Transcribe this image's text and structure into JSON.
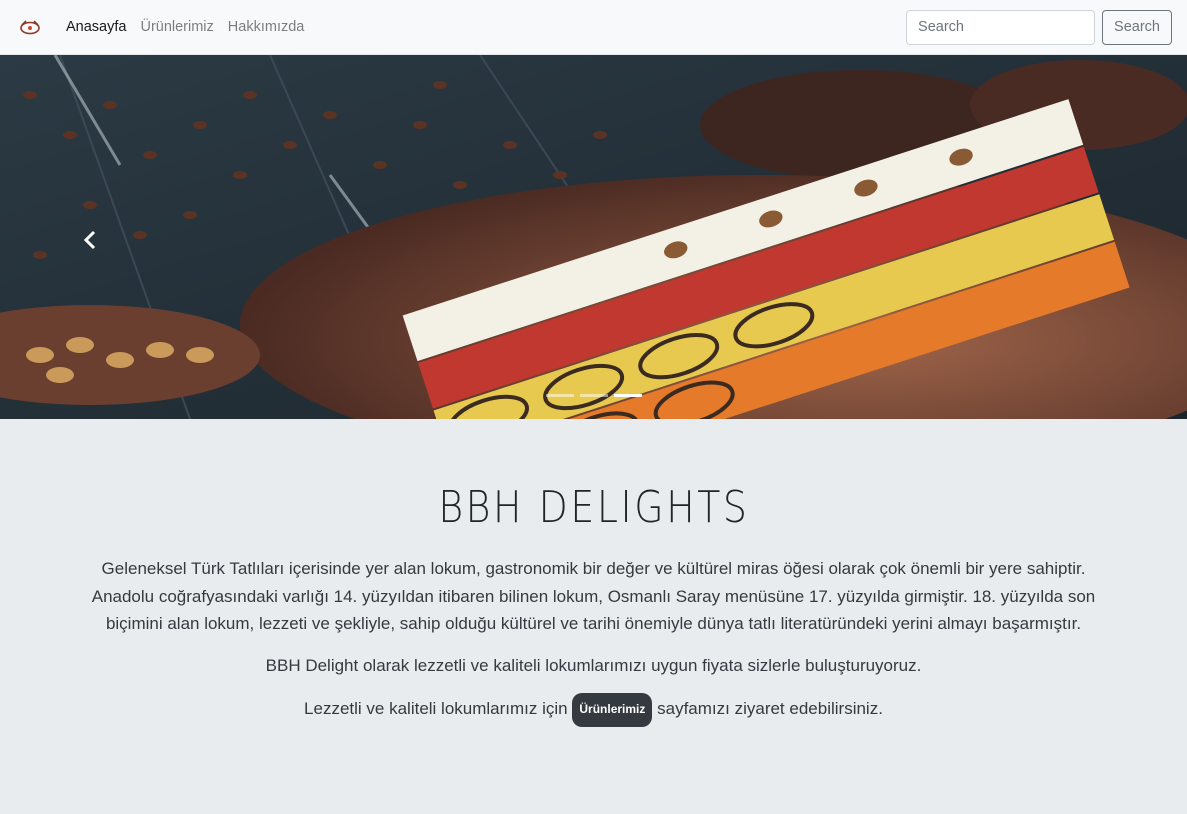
{
  "nav": {
    "brand_icon": "lokum-logo-icon",
    "links": [
      {
        "label": "Anasayfa",
        "active": true
      },
      {
        "label": "Ürünlerimiz",
        "active": false
      },
      {
        "label": "Hakkımızda",
        "active": false
      }
    ],
    "search": {
      "placeholder": "Search",
      "button_label": "Search"
    }
  },
  "carousel": {
    "prev_icon": "chevron-left-icon",
    "slides": 3,
    "active_slide": 3,
    "image": "turkish-delight-tray-photo"
  },
  "main": {
    "title": "BBH DELIGHTS",
    "paragraph1": "Geleneksel Türk Tatlıları içerisinde yer alan lokum, gastronomik bir değer ve kültürel miras öğesi olarak çok önemli bir yere sahiptir. Anadolu coğrafyasındaki varlığı 14. yüzyıldan itibaren bilinen lokum, Osmanlı Saray menüsüne 17. yüzyılda girmiştir. 18. yüzyılda son biçimini alan lokum, lezzeti ve şekliyle, sahip olduğu kültürel ve tarihi önemiyle dünya tatlı literatüründeki yerini almayı başarmıştır.",
    "paragraph2": "BBH Delight olarak lezzetli ve kaliteli lokumlarımızı uygun fiyata sizlerle buluşturuyoruz.",
    "paragraph3_before": "Lezzetli ve kaliteli lokumlarımız için",
    "paragraph3_badge": "Ürünlerimiz",
    "paragraph3_after": "sayfamızı ziyaret edebilirsiniz."
  },
  "colors": {
    "navbar_bg": "#f8f9fa",
    "page_bg": "#e9ecef",
    "badge_bg": "#343a40",
    "text": "#343a40"
  }
}
